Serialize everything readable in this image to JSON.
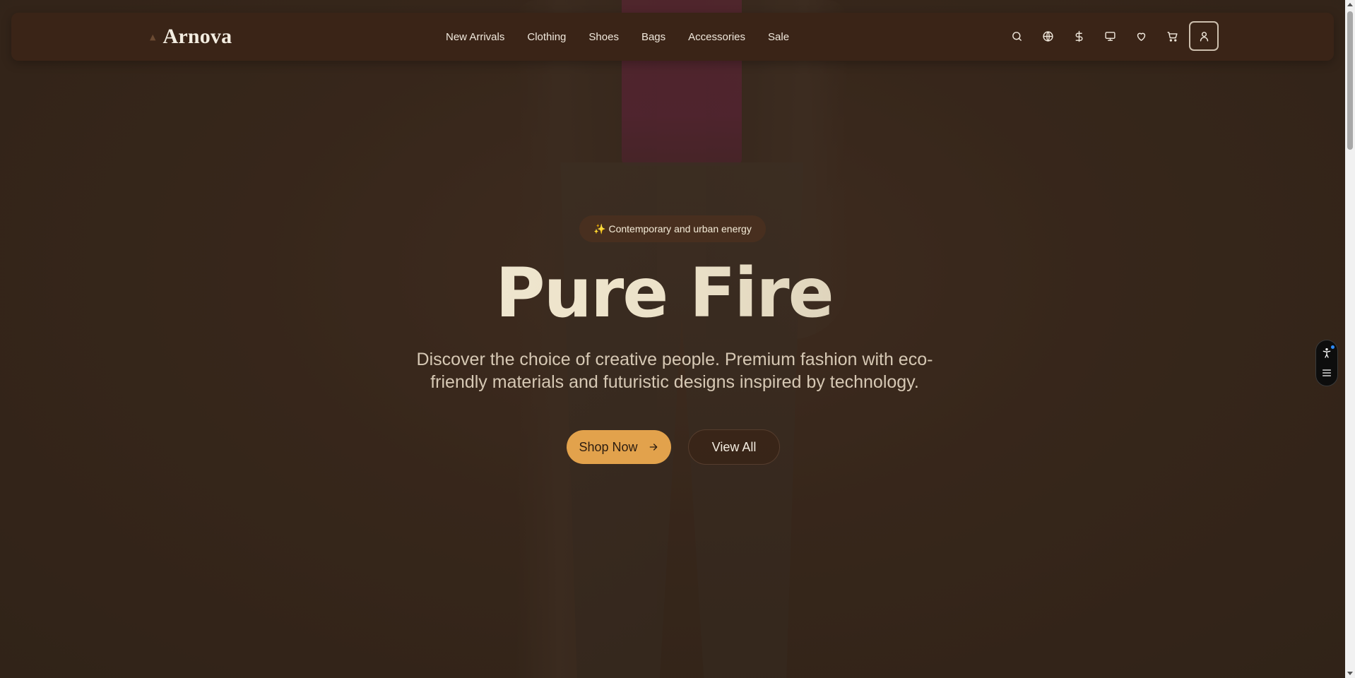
{
  "header": {
    "brand_name": "Arnova",
    "nav": [
      {
        "label": "New Arrivals"
      },
      {
        "label": "Clothing"
      },
      {
        "label": "Shoes"
      },
      {
        "label": "Bags"
      },
      {
        "label": "Accessories"
      },
      {
        "label": "Sale"
      }
    ],
    "actions": [
      "search-icon",
      "globe-icon",
      "dollar-icon",
      "display-icon",
      "heart-icon",
      "cart-icon",
      "user-icon"
    ]
  },
  "hero": {
    "badge": "✨ Contemporary and urban energy",
    "title": "Pure Fire",
    "subtitle": "Discover the choice of creative people. Premium fashion with eco-friendly materials and futuristic designs inspired by technology.",
    "primary_cta": "Shop Now",
    "secondary_cta": "View All"
  },
  "colors": {
    "header_bg": "#3a2417",
    "accent": "#e2a24c",
    "hero_bg": "#3e2b1f"
  }
}
